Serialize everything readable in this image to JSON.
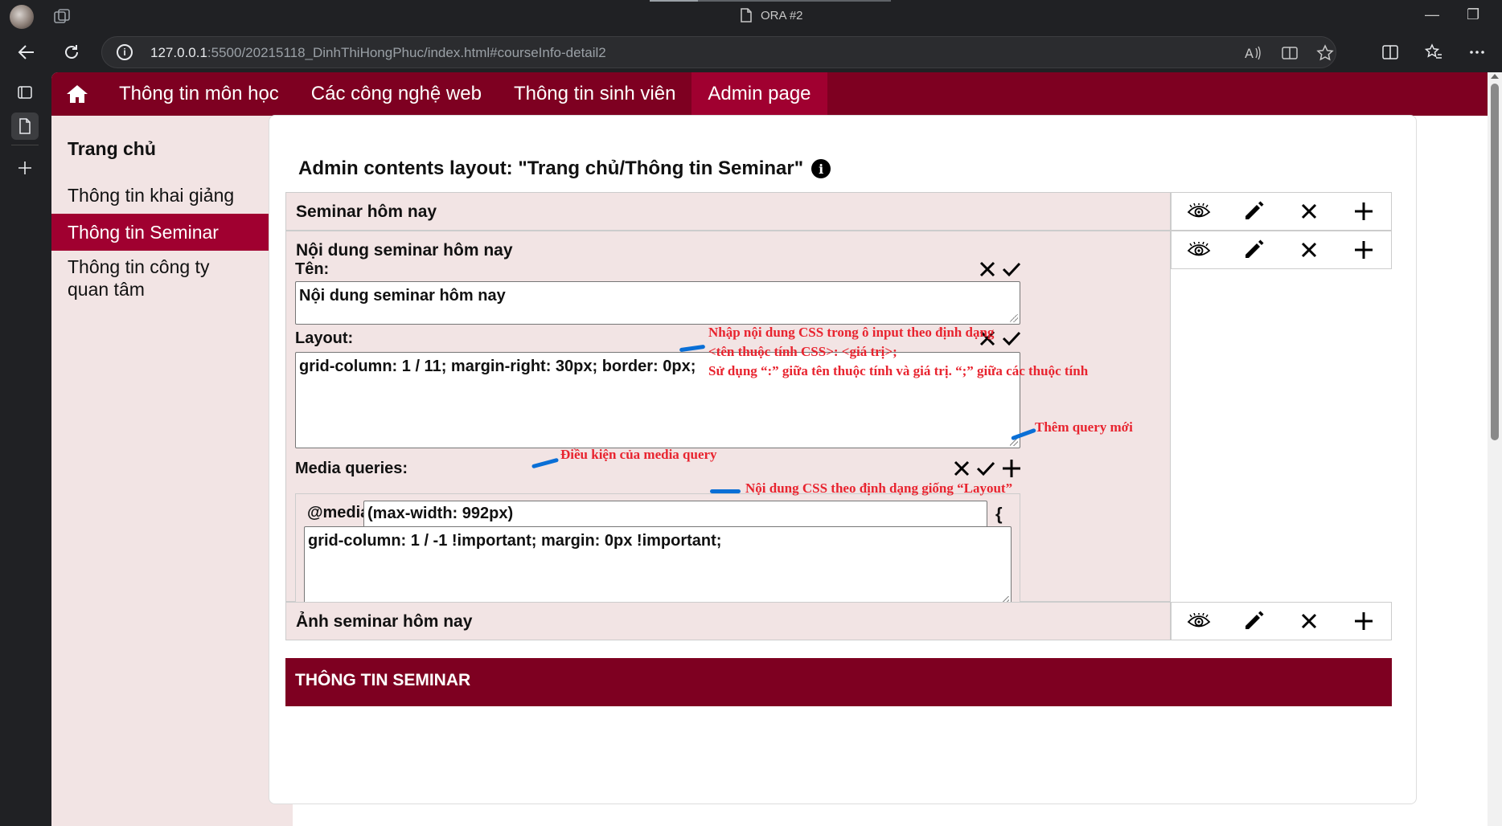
{
  "browser": {
    "tab_title": "ORA #2",
    "url_host": "127.0.0.1",
    "url_rest": ":5500/20215118_DinhThiHongPhuc/index.html#courseInfo-detail2",
    "minimize_glyph": "—",
    "restore_glyph": "❐"
  },
  "topnav": {
    "items": [
      "Thông tin môn học",
      "Các công nghệ web",
      "Thông tin sinh viên",
      "Admin page"
    ],
    "active_index": 3
  },
  "sidebar": {
    "title": "Trang chủ",
    "items": [
      "Thông tin khai giảng",
      "Thông tin Seminar",
      "Thông tin công ty\nquan tâm"
    ],
    "active_index": 1
  },
  "main": {
    "heading": "Admin contents layout: \"Trang chủ/Thông tin Seminar\"",
    "rows": [
      {
        "label": "Seminar hôm nay"
      },
      {
        "label": "Nội dung seminar hôm nay"
      },
      {
        "label": "Ảnh seminar hôm nay"
      }
    ],
    "editor": {
      "name_label": "Tên:",
      "name_value": "Nội dung seminar hôm nay",
      "layout_label": "Layout:",
      "layout_value": "grid-column: 1 / 11; margin-right: 30px; border: 0px;",
      "mq_label": "Media queries:",
      "mq_at": "@media",
      "mq_condition": "(max-width: 992px)",
      "mq_open_brace": "{",
      "mq_close_brace": "}",
      "mq_css": "grid-column: 1 / -1 !important; margin: 0px !important;"
    },
    "section_bar": "THÔNG TIN SEMINAR"
  },
  "annotations": {
    "layout_note_1": "Nhập nội dung CSS trong ô input theo định dạng",
    "layout_note_2": "<tên thuộc tính CSS>: <giá trị>;",
    "layout_note_3": "Sử dụng “:” giữa tên thuộc tính và giá trị. “;” giữa các thuộc tính",
    "add_query": "Thêm query mới",
    "mq_condition_note": "Điều kiện của media query",
    "mq_css_note": "Nội dung CSS theo định dạng giống “Layout”"
  },
  "colors": {
    "nav_bg": "#7e0021",
    "active_bg": "#a00030",
    "panel_bg": "#f2e4e4",
    "annotation_red": "#e8242f",
    "annotation_blue": "#0a6fd6"
  },
  "icons": [
    "home-icon",
    "eye-icon",
    "pencil-icon",
    "close-icon",
    "plus-icon",
    "check-icon",
    "info-icon"
  ]
}
